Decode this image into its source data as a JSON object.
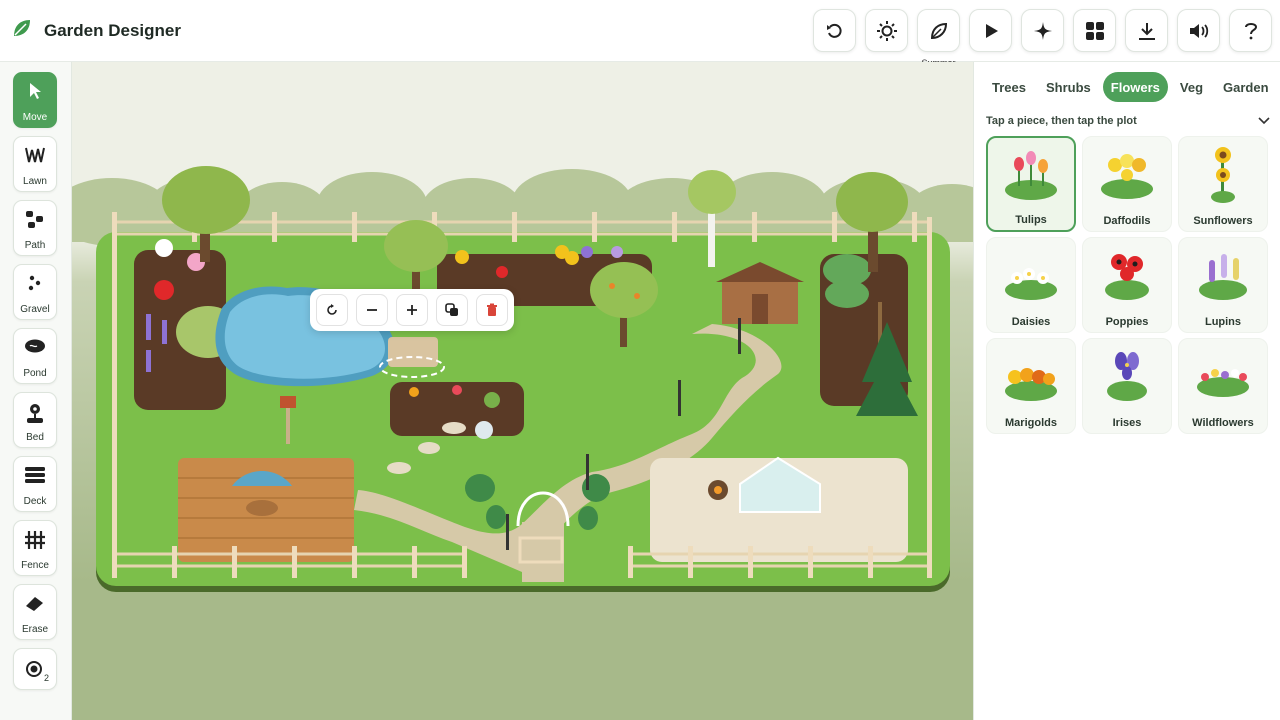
{
  "app": {
    "title": "Garden Designer"
  },
  "toolbar": {
    "buttons": [
      {
        "name": "undo-button",
        "icon": "undo-icon"
      },
      {
        "name": "daylight-button",
        "icon": "sun-icon"
      },
      {
        "name": "season-button",
        "icon": "leaf-icon",
        "caption": "Summer"
      },
      {
        "name": "play-button",
        "icon": "play-icon"
      },
      {
        "name": "sparkle-button",
        "icon": "sparkle-icon"
      },
      {
        "name": "grid-button",
        "icon": "grid-icon"
      },
      {
        "name": "download-button",
        "icon": "download-icon"
      },
      {
        "name": "sound-button",
        "icon": "speaker-icon"
      },
      {
        "name": "help-button",
        "icon": "question-icon"
      }
    ]
  },
  "tools": {
    "items": [
      {
        "label": "Move",
        "icon": "cursor-icon",
        "active": true
      },
      {
        "label": "Lawn",
        "icon": "grass-icon"
      },
      {
        "label": "Path",
        "icon": "stones-icon"
      },
      {
        "label": "Gravel",
        "icon": "gravel-icon"
      },
      {
        "label": "Pond",
        "icon": "pond-icon"
      },
      {
        "label": "Bed",
        "icon": "flower-bed-icon"
      },
      {
        "label": "Deck",
        "icon": "deck-icon"
      },
      {
        "label": "Fence",
        "icon": "fence-icon"
      },
      {
        "label": "Erase",
        "icon": "eraser-icon"
      }
    ],
    "brush": {
      "icon": "brush-size-icon",
      "size": "2"
    }
  },
  "float_toolbar": {
    "buttons": [
      {
        "name": "rotate-button",
        "icon": "rotate-icon"
      },
      {
        "name": "shrink-button",
        "icon": "minus-icon"
      },
      {
        "name": "grow-button",
        "icon": "plus-icon"
      },
      {
        "name": "duplicate-button",
        "icon": "duplicate-icon"
      },
      {
        "name": "delete-button",
        "icon": "trash-icon"
      }
    ]
  },
  "panel": {
    "tabs": [
      {
        "label": "Trees"
      },
      {
        "label": "Shrubs"
      },
      {
        "label": "Flowers",
        "active": true
      },
      {
        "label": "Veg"
      },
      {
        "label": "Garden"
      }
    ],
    "hint": "Tap a piece, then tap the plot",
    "items": [
      {
        "label": "Tulips",
        "selected": true,
        "colors": [
          "#e94a5a",
          "#f6a33a",
          "#f28bb7"
        ]
      },
      {
        "label": "Daffodils",
        "colors": [
          "#f5d230",
          "#f7e25a",
          "#f0b82a"
        ]
      },
      {
        "label": "Sunflowers",
        "colors": [
          "#f2c21c",
          "#7a4a1e"
        ]
      },
      {
        "label": "Daisies",
        "colors": [
          "#ffffff",
          "#f6d24a"
        ]
      },
      {
        "label": "Poppies",
        "colors": [
          "#e0282a",
          "#1e1e1e"
        ]
      },
      {
        "label": "Lupins",
        "colors": [
          "#9a6fd0",
          "#e6d26a",
          "#c7b0ea"
        ]
      },
      {
        "label": "Marigolds",
        "colors": [
          "#f2a21b",
          "#f6c21e",
          "#e06a18"
        ]
      },
      {
        "label": "Irises",
        "colors": [
          "#5a48b8",
          "#7e6ad0",
          "#f2d050"
        ]
      },
      {
        "label": "Wildflowers",
        "colors": [
          "#e94a5a",
          "#f6d24a",
          "#9a6fd0",
          "#ffffff"
        ]
      }
    ]
  },
  "colors": {
    "accent": "#4ea05a",
    "lawn": "#7cbf4a",
    "soil": "#5a3a26",
    "water": "#5cb3d6"
  }
}
